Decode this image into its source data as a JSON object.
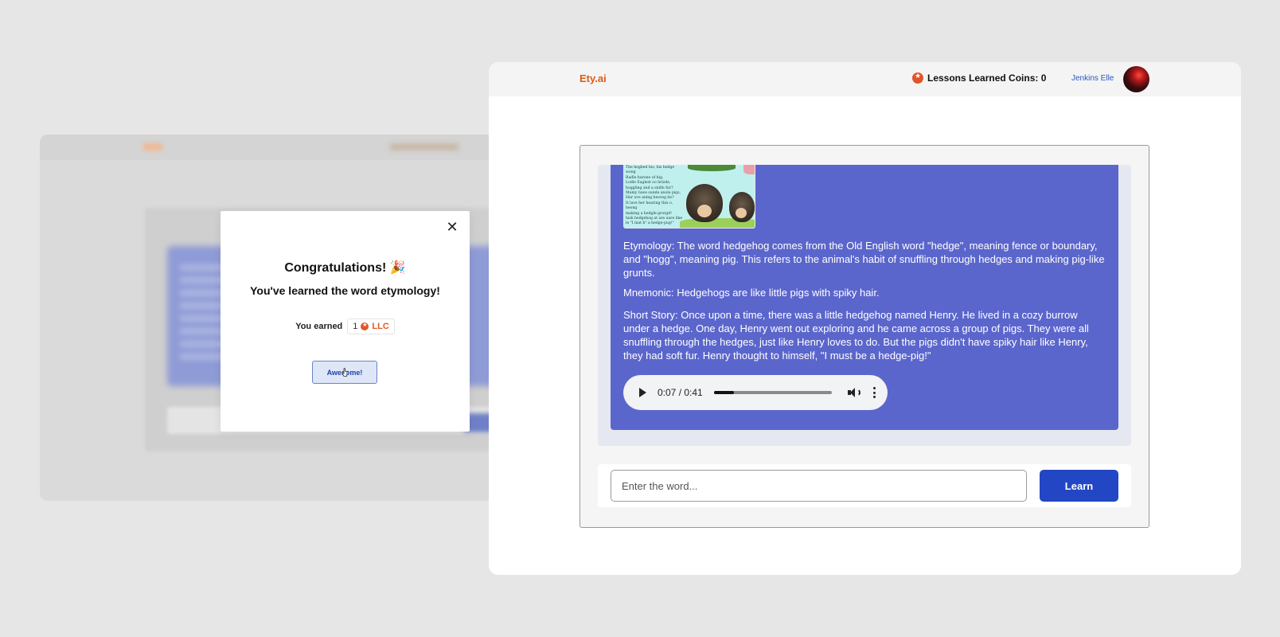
{
  "modal": {
    "title": "Congratulations! 🎉",
    "subtitle": "You've learned the word etymology!",
    "earned_label": "You earned",
    "earned_amount": "1",
    "earned_unit": "LLC",
    "button_label": "Awesome!",
    "close_icon": "close-icon"
  },
  "app": {
    "logo": "Ety.ai",
    "coins_label": "Lessons Learned Coins: 0",
    "user_name": "Jenkins Elle",
    "accent_color": "#e05a14",
    "primary_color": "#2347c4",
    "card_color": "#5b66cc"
  },
  "result": {
    "image_text": [
      "The hogbed his, his hedge wong",
      "Radle harone of hig.",
      "Lodle Eaglest oo hrizde,",
      "hoggling and a snifle fur?",
      "Mamy luwe sunde anole pigs,",
      "Har uve aning hesveg lie?",
      "It lave her hearing this o, heong",
      "making a hedgle-grorgd!",
      "hisk hedgehog at are aure like",
      "le \"I mat h\" a hedge-pug!\""
    ],
    "etymology": "Etymology: The word hedgehog comes from the Old English word \"hedge\", meaning fence or boundary, and \"hogg\", meaning pig. This refers to the animal's habit of snuffling through hedges and making pig-like grunts.",
    "mnemonic": "Mnemonic: Hedgehogs are like little pigs with spiky hair.",
    "story": "Short Story: Once upon a time, there was a little hedgehog named Henry. He lived in a cozy burrow under a hedge. One day, Henry went out exploring and he came across a group of pigs. They were all snuffling through the hedges, just like Henry loves to do. But the pigs didn't have spiky hair like Henry, they had soft fur. Henry thought to himself, \"I must be a hedge-pig!\""
  },
  "audio": {
    "time": "0:07 / 0:41",
    "progress": 0.17
  },
  "search": {
    "placeholder": "Enter the word...",
    "button_label": "Learn"
  }
}
